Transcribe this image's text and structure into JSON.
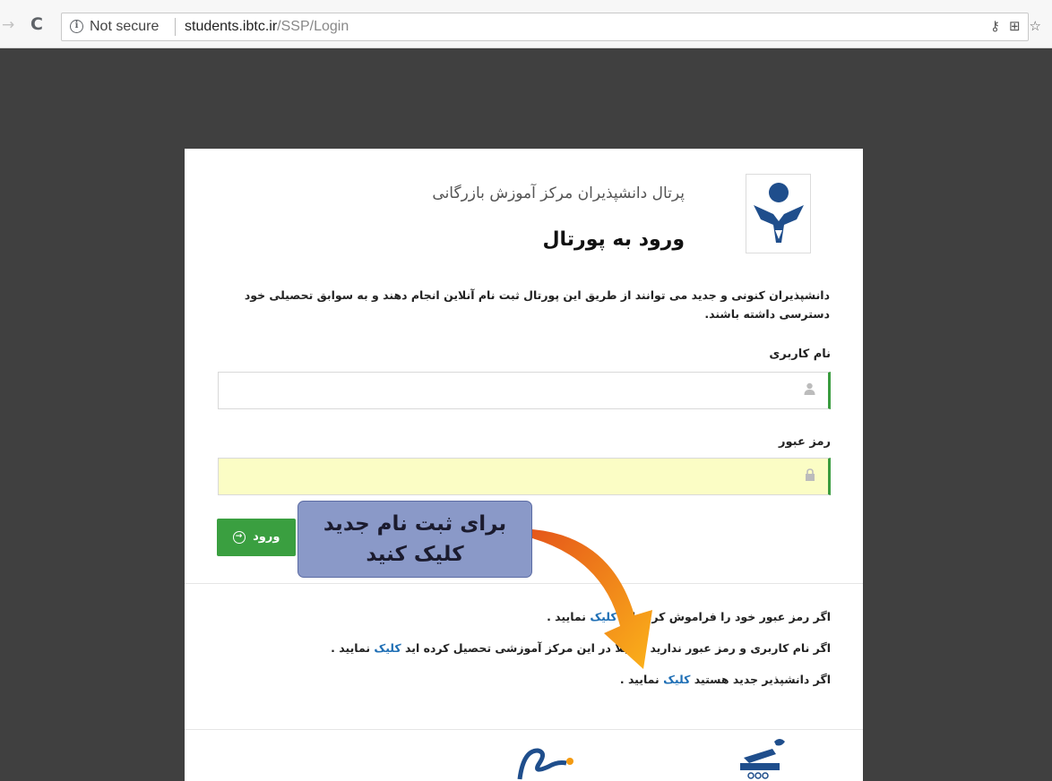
{
  "browser": {
    "security_label": "Not secure",
    "url_host": "students.ibtc.ir",
    "url_path": "/SSP/Login"
  },
  "portal": {
    "subtitle": "پرتال دانشپذیران مرکز آموزش بازرگانی",
    "title": "ورود به پورتال",
    "description": "دانشپذیران کنونی و جدید می توانند از طریق این پورتال ثبت نام آنلاین انجام دهند و به سوابق تحصیلی خود دسترسی داشته باشند."
  },
  "form": {
    "username_label": "نام کاربری",
    "username_value": "",
    "password_label": "رمز عبور",
    "password_value": "",
    "login_button": "ورود"
  },
  "links": {
    "forgot_prefix": "اگر رمز عبور خود را فراموش کرده اید",
    "forgot_link": "کلیک",
    "forgot_suffix": "نمایید .",
    "former_prefix": "اگر نام کاربری و رمز عبور ندارید و قبلا در این مرکز آموزشی تحصیل کرده اید",
    "former_link": "کلیک",
    "former_suffix": "نمایید .",
    "new_prefix": "اگر دانشپذیر جدید هستید",
    "new_link": "کلیک",
    "new_suffix": "نمایید ."
  },
  "callout": {
    "line1": "برای ثبت نام جدید",
    "line2": "کلیک کنید",
    "color": "#8a99c8",
    "arrow_color": "#f39a12"
  },
  "colors": {
    "primary_green": "#3a9f40",
    "logo_blue": "#1f4e8c",
    "link_blue": "#1f6fb5"
  }
}
